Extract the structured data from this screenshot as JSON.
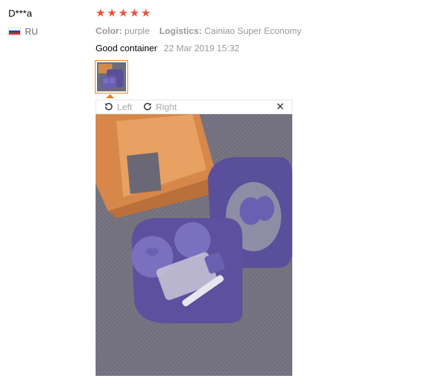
{
  "review": {
    "user_name": "D***a",
    "country_code": "RU",
    "flag_colors": [
      "#ffffff",
      "#1c48a8",
      "#d52b1e"
    ],
    "star_color": "#f0503c",
    "stars": [
      "★",
      "★",
      "★",
      "★",
      "★"
    ],
    "attributes": [
      {
        "key": "Color:",
        "value": "purple"
      },
      {
        "key": "Logistics:",
        "value": "Cainiao Super Economy"
      }
    ],
    "text": "Good container",
    "date": "22 Mar 2019 15:32"
  },
  "viewer": {
    "rotate_left_label": "Left",
    "rotate_right_label": "Right",
    "close_glyph": "✕",
    "accent_color": "#e67e22"
  }
}
